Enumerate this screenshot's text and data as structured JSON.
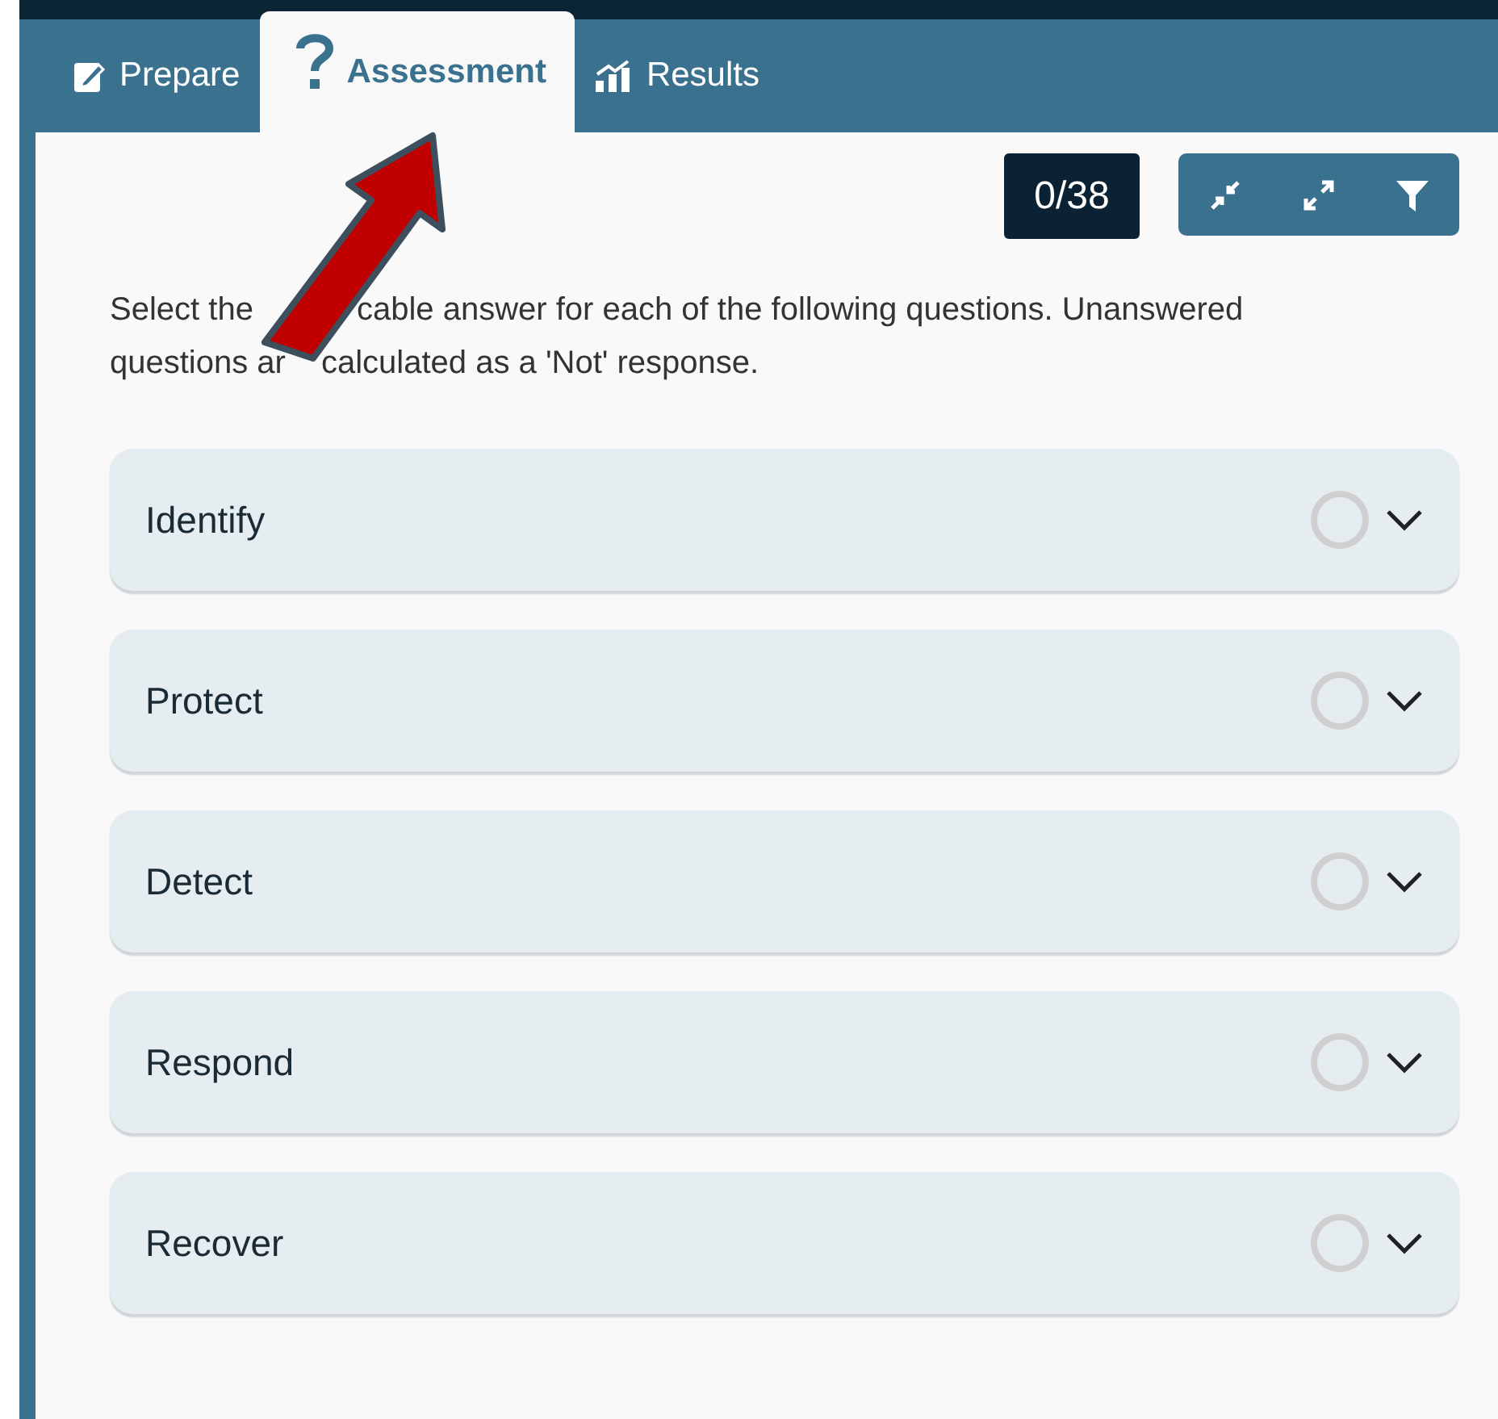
{
  "tabs": [
    {
      "label": "Prepare",
      "kind": "prepare",
      "selected": false
    },
    {
      "label": "Assessment",
      "kind": "assessment",
      "selected": true
    },
    {
      "label": "Results",
      "kind": "results",
      "selected": false
    }
  ],
  "progress": {
    "counter": "0/38"
  },
  "toolbar": [
    {
      "kind": "collapse"
    },
    {
      "kind": "expand"
    },
    {
      "kind": "filter"
    }
  ],
  "instructions": [
    [
      "Select the",
      "cable answer for each of the following questions. Unanswered"
    ],
    [
      "questions ar",
      "calculated as a 'Not' response."
    ]
  ],
  "sections": [
    {
      "title": "Identify",
      "expanded": false
    },
    {
      "title": "Protect",
      "expanded": false
    },
    {
      "title": "Detect",
      "expanded": false
    },
    {
      "title": "Respond",
      "expanded": false
    },
    {
      "title": "Recover",
      "expanded": false
    }
  ]
}
